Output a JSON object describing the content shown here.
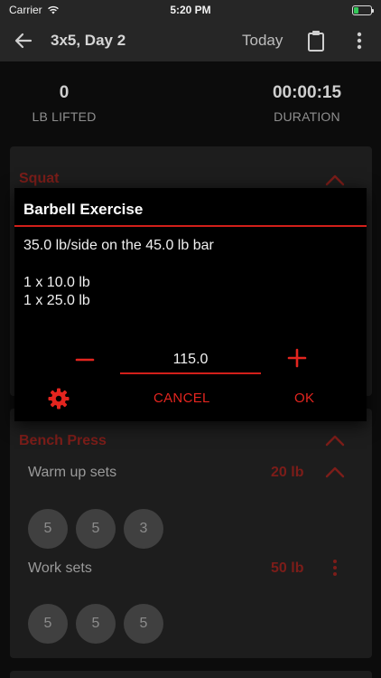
{
  "status_bar": {
    "carrier": "Carrier",
    "time": "5:20 PM",
    "battery_color": "#34c759"
  },
  "app_bar": {
    "title": "3x5, Day 2",
    "today_label": "Today",
    "icons": [
      "back-arrow-icon",
      "clipboard-icon",
      "more-vertical-icon"
    ]
  },
  "stats": {
    "lifted_value": "0",
    "lifted_label": "LB LIFTED",
    "duration_value": "00:00:15",
    "duration_label": "DURATION"
  },
  "exercises": [
    {
      "name": "Squat"
    },
    {
      "name": "Bench Press",
      "warmup_label": "Warm up sets",
      "warmup_weight": "20 lb",
      "warmup_reps": [
        "5",
        "5",
        "3"
      ],
      "work_label": "Work sets",
      "work_weight": "50 lb",
      "work_reps": [
        "5",
        "5",
        "5"
      ]
    }
  ],
  "dialog": {
    "title": "Barbell Exercise",
    "summary": "35.0 lb/side on the 45.0 lb bar",
    "plates": [
      "1 x 10.0 lb",
      "1 x 25.0 lb"
    ],
    "value": "115.0",
    "cancel_label": "CANCEL",
    "ok_label": "OK"
  },
  "colors": {
    "accent": "#e3251f",
    "accent_dim": "#7c1d19",
    "surface": "#1d1d1d",
    "background": "#0c0c0c"
  }
}
